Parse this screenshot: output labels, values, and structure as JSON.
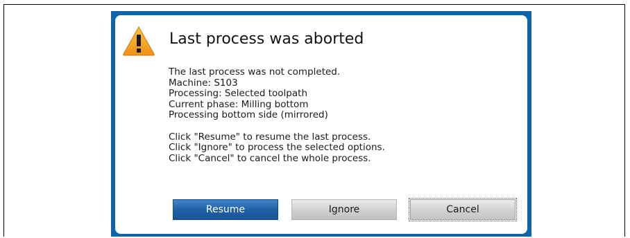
{
  "dialog": {
    "title": "Last process was aborted",
    "icon": "warning-icon",
    "message_lines": [
      "The last process was not completed.",
      "Machine: S103",
      "Processing: Selected toolpath",
      "Current phase: Milling bottom",
      "Processing bottom side (mirrored)"
    ],
    "instruction_lines": [
      "Click \"Resume\" to resume the last process.",
      "Click \"Ignore\" to process the selected options.",
      "Click \"Cancel\" to cancel the whole process."
    ],
    "buttons": {
      "resume": "Resume",
      "ignore": "Ignore",
      "cancel": "Cancel"
    }
  },
  "colors": {
    "frame_blue": "#0e64a8",
    "resume_blue": "#1d5fa3",
    "warning_orange": "#f0a020"
  }
}
